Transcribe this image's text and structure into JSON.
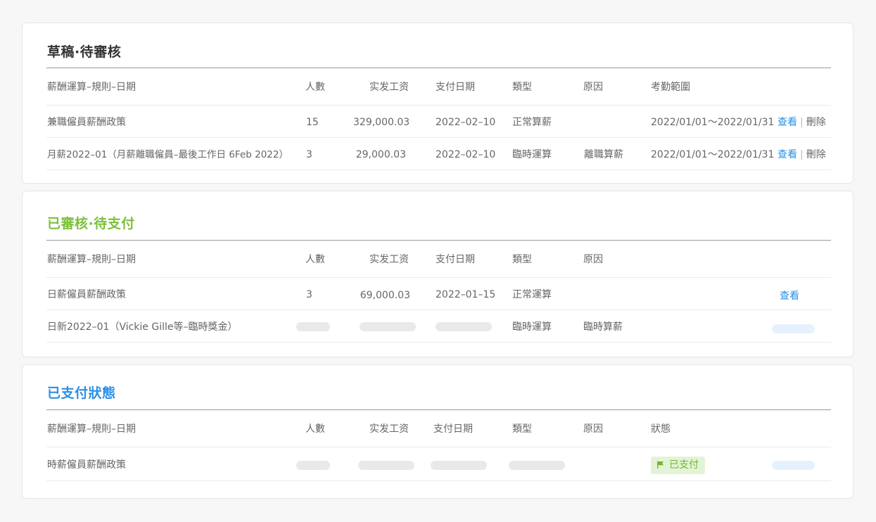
{
  "colors": {
    "draft_title": "#333333",
    "approved_title": "#7cbf3a",
    "paid_title": "#2a8fe6",
    "link": "#2a8fe6",
    "badge_bg": "#e4f3d6",
    "badge_text": "#6cb82f"
  },
  "draft": {
    "title": "草稿·待審核",
    "headers": {
      "name": "薪酬運算–規則–日期",
      "count": "人數",
      "amount": "实发工资",
      "pay_date": "支付日期",
      "type": "類型",
      "reason": "原因",
      "period": "考勤範圍"
    },
    "rows": [
      {
        "name": "兼職僱員薪酬政策",
        "count": "15",
        "amount": "329,000.03",
        "pay_date": "2022–02–10",
        "type": "正常算薪",
        "reason": "",
        "period": "2022/01/01～2022/01/31",
        "view": "查看",
        "sep": "|",
        "delete": "刪除"
      },
      {
        "name": "月薪2022–01（月薪離職僱員–最後工作日 6Feb 2022）",
        "count": "3",
        "amount": "29,000.03",
        "pay_date": "2022–02–10",
        "type": "臨時運算",
        "reason": "離職算薪",
        "period": "2022/01/01～2022/01/31",
        "view": "查看",
        "sep": "|",
        "delete": "刪除"
      }
    ]
  },
  "approved": {
    "title": "已審核·待支付",
    "headers": {
      "name": "薪酬運算–規則–日期",
      "count": "人數",
      "amount": "实发工资",
      "pay_date": "支付日期",
      "type": "類型",
      "reason": "原因"
    },
    "rows": [
      {
        "name": "日薪僱員薪酬政策",
        "count": "3",
        "amount": "69,000.03",
        "pay_date": "2022–01–15",
        "type": "正常運算",
        "reason": "",
        "view": "查看"
      },
      {
        "name": "日新2022–01（Vickie Gille等–臨時獎金）",
        "type": "臨時運算",
        "reason": "臨時算薪"
      }
    ]
  },
  "paid": {
    "title": "已支付狀態",
    "headers": {
      "name": "薪酬運算–規則–日期",
      "count": "人數",
      "amount": "实发工资",
      "pay_date": "支付日期",
      "type": "類型",
      "reason": "原因",
      "status": "狀態"
    },
    "rows": [
      {
        "name": "時薪僱員薪酬政策",
        "status": "已支付",
        "status_icon": "flag-icon"
      }
    ]
  }
}
